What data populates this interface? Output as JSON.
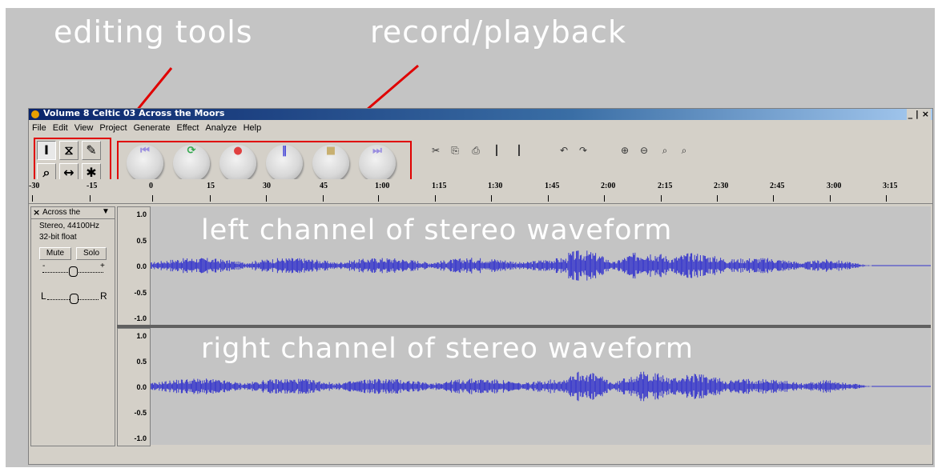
{
  "callouts": {
    "editing_tools": "editing tools",
    "record_playback": "record/playback",
    "left_channel": "left channel of stereo waveform",
    "right_channel": "right channel of stereo waveform"
  },
  "window": {
    "title": "Volume 8 Celtic 03 Across the Moors",
    "controls": "_ | ×"
  },
  "menu": [
    "File",
    "Edit",
    "View",
    "Project",
    "Generate",
    "Effect",
    "Analyze",
    "Help"
  ],
  "tools": {
    "row1": [
      {
        "icon": "selection-tool-icon",
        "glyph": "I"
      },
      {
        "icon": "envelope-tool-icon",
        "glyph": "⧖"
      },
      {
        "icon": "draw-tool-icon",
        "glyph": "✎"
      }
    ],
    "row2": [
      {
        "icon": "zoom-tool-icon",
        "glyph": "⌕"
      },
      {
        "icon": "timeshift-tool-icon",
        "glyph": "↔"
      },
      {
        "icon": "multi-tool-icon",
        "glyph": "✱"
      }
    ]
  },
  "transport": [
    {
      "name": "skip-to-start",
      "glyph": "⏮",
      "color": "#9a8ee0"
    },
    {
      "name": "play",
      "glyph": "⟳",
      "color": "#2fa84a"
    },
    {
      "name": "record",
      "glyph": "●",
      "color": "#e04040"
    },
    {
      "name": "pause",
      "glyph": "‖",
      "color": "#3b3bd6"
    },
    {
      "name": "stop",
      "glyph": "■",
      "color": "#c8b070"
    },
    {
      "name": "skip-to-end",
      "glyph": "⏭",
      "color": "#9a8ee0"
    }
  ],
  "edit_toolbar": [
    {
      "name": "cut-icon",
      "glyph": "✂"
    },
    {
      "name": "copy-icon",
      "glyph": "⎘"
    },
    {
      "name": "paste-icon",
      "glyph": "⎙"
    },
    {
      "name": "trim-icon",
      "glyph": "┃"
    },
    {
      "name": "silence-icon",
      "glyph": "┃"
    },
    {
      "name": "undo-icon",
      "glyph": "↶"
    },
    {
      "name": "redo-icon",
      "glyph": "↷"
    },
    {
      "name": "zoom-in-icon",
      "glyph": "⊕"
    },
    {
      "name": "zoom-out-icon",
      "glyph": "⊖"
    },
    {
      "name": "fit-selection-icon",
      "glyph": "⌕"
    },
    {
      "name": "fit-project-icon",
      "glyph": "⌕"
    }
  ],
  "ruler": [
    "-30",
    "-15",
    "0",
    "15",
    "30",
    "45",
    "1:00",
    "1:15",
    "1:30",
    "1:45",
    "2:00",
    "2:15",
    "2:30",
    "2:45",
    "3:00",
    "3:15"
  ],
  "track": {
    "name": "Across the",
    "format": "Stereo, 44100Hz",
    "bitdepth": "32-bit float",
    "mute": "Mute",
    "solo": "Solo",
    "pan_left": "L",
    "pan_right": "R",
    "gain_minus": "-",
    "gain_plus": "+"
  },
  "vscale": [
    "1.0",
    "0.5",
    "0.0",
    "-0.5",
    "-1.0"
  ],
  "colors": {
    "waveform": "#3333cc",
    "annotation": "#e00000"
  }
}
